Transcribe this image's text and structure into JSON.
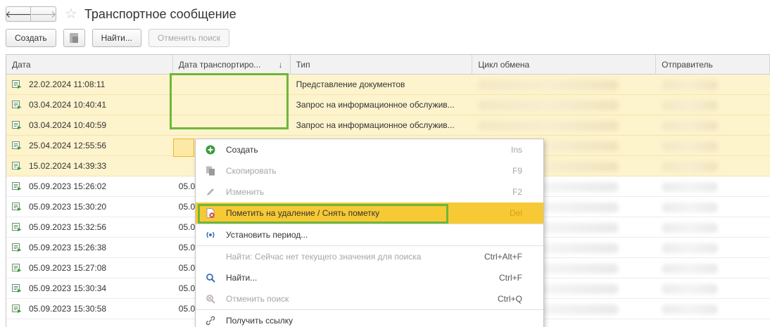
{
  "window": {
    "title": "Транспортное сообщение",
    "back_glyph": "🡐",
    "forward_glyph": "🡒"
  },
  "toolbar": {
    "create_label": "Создать",
    "find_label": "Найти...",
    "cancel_search_label": "Отменить поиск"
  },
  "table": {
    "columns": [
      {
        "label": "Дата"
      },
      {
        "label": "Дата транспортиро..."
      },
      {
        "label": "Тип"
      },
      {
        "label": "Цикл обмена"
      },
      {
        "label": "Отправитель"
      }
    ],
    "sort_indicator": "↓",
    "rows": [
      {
        "date": "22.02.2024 11:08:11",
        "transport_date": "",
        "type": "Представление документов"
      },
      {
        "date": "03.04.2024 10:40:41",
        "transport_date": "",
        "type": "Запрос на информационное обслужив..."
      },
      {
        "date": "03.04.2024 10:40:59",
        "transport_date": "",
        "type": "Запрос на информационное обслужив..."
      },
      {
        "date": "25.04.2024 12:55:56",
        "transport_date": "",
        "type": ""
      },
      {
        "date": "15.02.2024 14:39:33",
        "transport_date": "",
        "type": ""
      },
      {
        "date": "05.09.2023 15:26:02",
        "transport_date": "05.0",
        "type": ""
      },
      {
        "date": "05.09.2023 15:30:20",
        "transport_date": "05.0",
        "type": ""
      },
      {
        "date": "05.09.2023 15:32:56",
        "transport_date": "05.0",
        "type": ""
      },
      {
        "date": "05.09.2023 15:26:38",
        "transport_date": "05.0",
        "type": ""
      },
      {
        "date": "05.09.2023 15:27:08",
        "transport_date": "05.0",
        "type": ""
      },
      {
        "date": "05.09.2023 15:30:34",
        "transport_date": "05.0",
        "type": ""
      },
      {
        "date": "05.09.2023 15:30:58",
        "transport_date": "05.0",
        "type": ""
      }
    ]
  },
  "context_menu": {
    "items": [
      {
        "label": "Создать",
        "shortcut": "Ins"
      },
      {
        "label": "Скопировать",
        "shortcut": "F9"
      },
      {
        "label": "Изменить",
        "shortcut": "F2"
      },
      {
        "label": "Пометить на удаление / Снять пометку",
        "shortcut": "Del"
      },
      {
        "label": "Установить период...",
        "shortcut": ""
      },
      {
        "label": "Найти: Сейчас нет текущего значения для поиска",
        "shortcut": "Ctrl+Alt+F"
      },
      {
        "label": "Найти...",
        "shortcut": "Ctrl+F"
      },
      {
        "label": "Отменить поиск",
        "shortcut": "Ctrl+Q"
      },
      {
        "label": "Получить ссылку",
        "shortcut": ""
      }
    ]
  },
  "colors": {
    "highlight_row": "#fdf3cc",
    "menu_active": "#f7c935",
    "annotation_green": "#6fb63b",
    "icon_green": "#3a9b3a"
  }
}
